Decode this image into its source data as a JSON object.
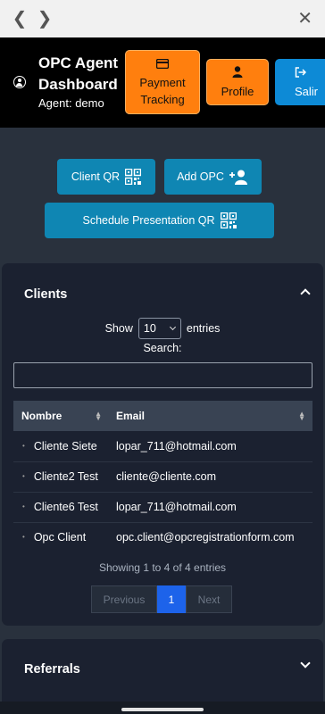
{
  "browser": {
    "back_icon": "chevron-left",
    "forward_icon": "chevron-right",
    "close_icon": "close"
  },
  "header": {
    "title": "OPC Agent Dashboard",
    "agent": "Agent: demo",
    "buttons": [
      {
        "label": "Payment Tracking",
        "icon": "credit-card",
        "color": "#ff7f0e"
      },
      {
        "label": "Profile",
        "icon": "user",
        "color": "#ff7f0e"
      },
      {
        "label": "Salir",
        "icon": "sign-out",
        "color": "#0d8ad6"
      }
    ]
  },
  "actions": {
    "client_qr": "Client QR",
    "add_opc": "Add OPC",
    "schedule_qr": "Schedule Presentation QR"
  },
  "clients": {
    "title": "Clients",
    "show": "Show",
    "entries_value": "10",
    "entries": "entries",
    "search_label": "Search:",
    "search_value": "",
    "columns": [
      "Nombre",
      "Email"
    ],
    "rows": [
      {
        "name": "Cliente Siete",
        "email": "lopar_711@hotmail.com"
      },
      {
        "name": "Cliente2 Test",
        "email": "cliente@cliente.com"
      },
      {
        "name": "Cliente6 Test",
        "email": "lopar_711@hotmail.com"
      },
      {
        "name": "Opc Client",
        "email": "opc.client@opcregistrationform.com"
      }
    ],
    "showing": "Showing 1 to 4 of 4 entries",
    "pagination": {
      "previous": "Previous",
      "current": "1",
      "next": "Next"
    }
  },
  "referrals": {
    "title": "Referrals"
  },
  "colors": {
    "accent_orange": "#ff7f0e",
    "accent_blue": "#0f86b3",
    "page_active": "#1d63ea"
  }
}
